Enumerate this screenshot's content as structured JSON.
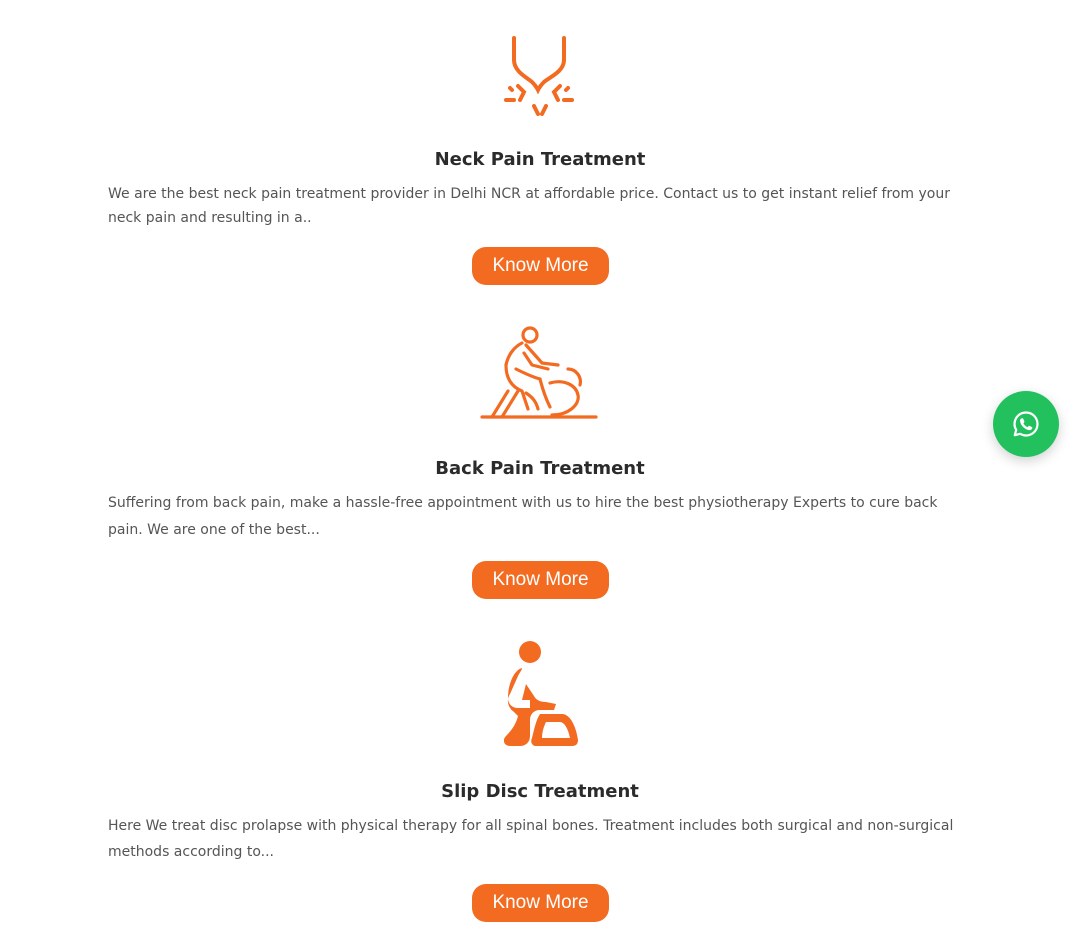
{
  "colors": {
    "accent": "#f26b21",
    "whatsapp": "#22c15e",
    "title": "#2b2b2b",
    "text": "#555555"
  },
  "services": [
    {
      "icon": "neck-icon",
      "title": "Neck Pain Treatment",
      "description": "We are the best neck pain treatment provider in Delhi NCR at affordable price. Contact us to get instant relief from your neck pain and resulting in a..",
      "button_label": "Know More"
    },
    {
      "icon": "back-therapy-icon",
      "title": "Back Pain Treatment",
      "description": "Suffering from back pain, make a hassle-free appointment with us to hire the best physiotherapy Experts to cure back pain. We are one of the best...",
      "button_label": "Know More"
    },
    {
      "icon": "slip-disc-icon",
      "title": "Slip Disc Treatment",
      "description": "Here We treat disc prolapse with physical therapy for all spinal bones. Treatment includes both surgical and non-surgical methods according to...",
      "button_label": "Know More"
    }
  ],
  "floating_button": {
    "icon": "whatsapp-icon"
  }
}
